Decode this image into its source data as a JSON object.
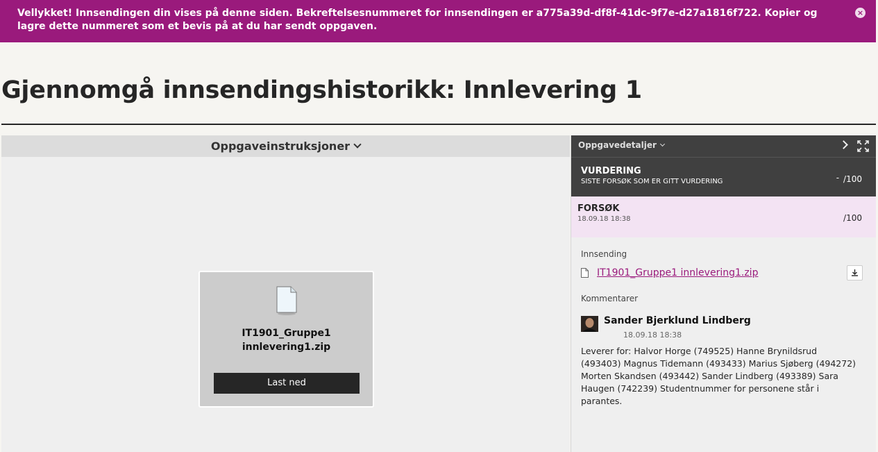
{
  "banner": {
    "message": "Vellykket! Innsendingen din vises på denne siden. Bekreftelsesnummeret for innsendingen er a775a39d-df8f-41dc-9f7e-d27a1816f722. Kopier og lagre dette nummeret som et bevis på at du har sendt oppgaven.",
    "close_icon": "×"
  },
  "page": {
    "title": "Gjennomgå innsendingshistorikk: Innlevering 1"
  },
  "instructions": {
    "label": "Oppgaveinstruksjoner"
  },
  "file_card": {
    "name_line1": "IT1901_Gruppe1",
    "name_line2": "innlevering1.zip",
    "download_label": "Last ned"
  },
  "details": {
    "header_label": "Oppgavedetaljer",
    "grade": {
      "title": "VURDERING",
      "subtitle": "SISTE FORSØK SOM ER GITT VURDERING",
      "score": "-",
      "max": "/100"
    },
    "attempt": {
      "title": "FORSØK",
      "date": "18.09.18 18:38",
      "max": "/100"
    },
    "submission_label": "Innsending",
    "submission_file": "IT1901_Gruppe1 innlevering1.zip",
    "comments_label": "Kommentarer",
    "comment": {
      "author": "Sander Bjerklund Lindberg",
      "date": "18.09.18 18:38",
      "text": "Leverer for:  Halvor Horge (749525)  Hanne Brynildsrud (493403) Magnus Tidemann (493433)  Marius Sjøberg (494272) Morten Skandsen (493442)  Sander Lindberg (493389) Sara Haugen (742239)  Studentnummer for personene står i parantes."
    }
  },
  "colors": {
    "accent": "#9a1a7c",
    "dark_panel": "#404040",
    "attempt_bg": "#f3e3f3"
  },
  "icons": [
    "close-icon",
    "chevron-down-icon",
    "file-icon",
    "chevron-right-icon",
    "expand-icon",
    "document-icon",
    "download-icon",
    "avatar"
  ]
}
